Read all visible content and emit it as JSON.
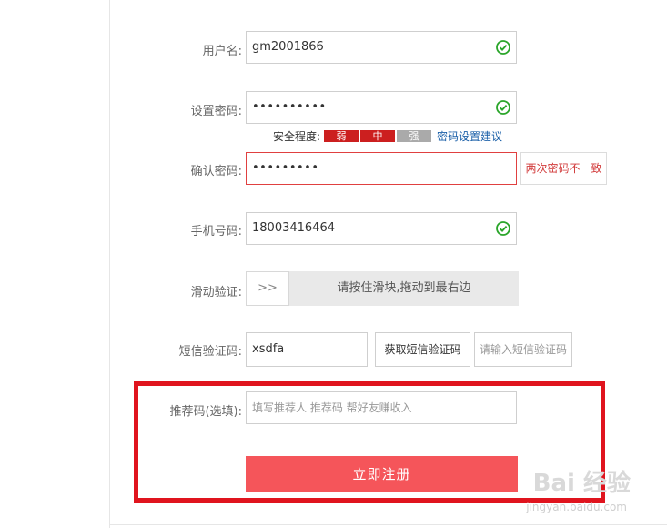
{
  "form": {
    "username": {
      "label": "用户名:",
      "value": "gm2001866"
    },
    "password": {
      "label": "设置密码:",
      "value": "••••••••••"
    },
    "strength": {
      "label": "安全程度:",
      "levels": [
        "弱",
        "中",
        "强"
      ],
      "colors": [
        "#cc1f1f",
        "#cc1f1f",
        "#aaaaaa"
      ],
      "advice_link": "密码设置建议"
    },
    "confirm": {
      "label": "确认密码:",
      "value": "•••••••••",
      "error": "两次密码不一致"
    },
    "phone": {
      "label": "手机号码:",
      "value": "18003416464"
    },
    "slider": {
      "label": "滑动验证:",
      "handle": ">>",
      "text": "请按住滑块,拖动到最右边"
    },
    "sms": {
      "label": "短信验证码:",
      "value": "xsdfa",
      "button": "获取短信验证码",
      "placeholder": "请输入短信验证码"
    },
    "referral": {
      "label": "推荐码(选填):",
      "placeholder": "填写推荐人 推荐码 帮好友赚收入"
    },
    "submit_label": "立即注册"
  },
  "watermark": {
    "logo": "Bai 经验",
    "url": "jingyan.baidu.com"
  },
  "colors": {
    "check": "#2aa52a",
    "error_border": "#e04040",
    "highlight": "#e0141e",
    "submit": "#f5555a"
  }
}
